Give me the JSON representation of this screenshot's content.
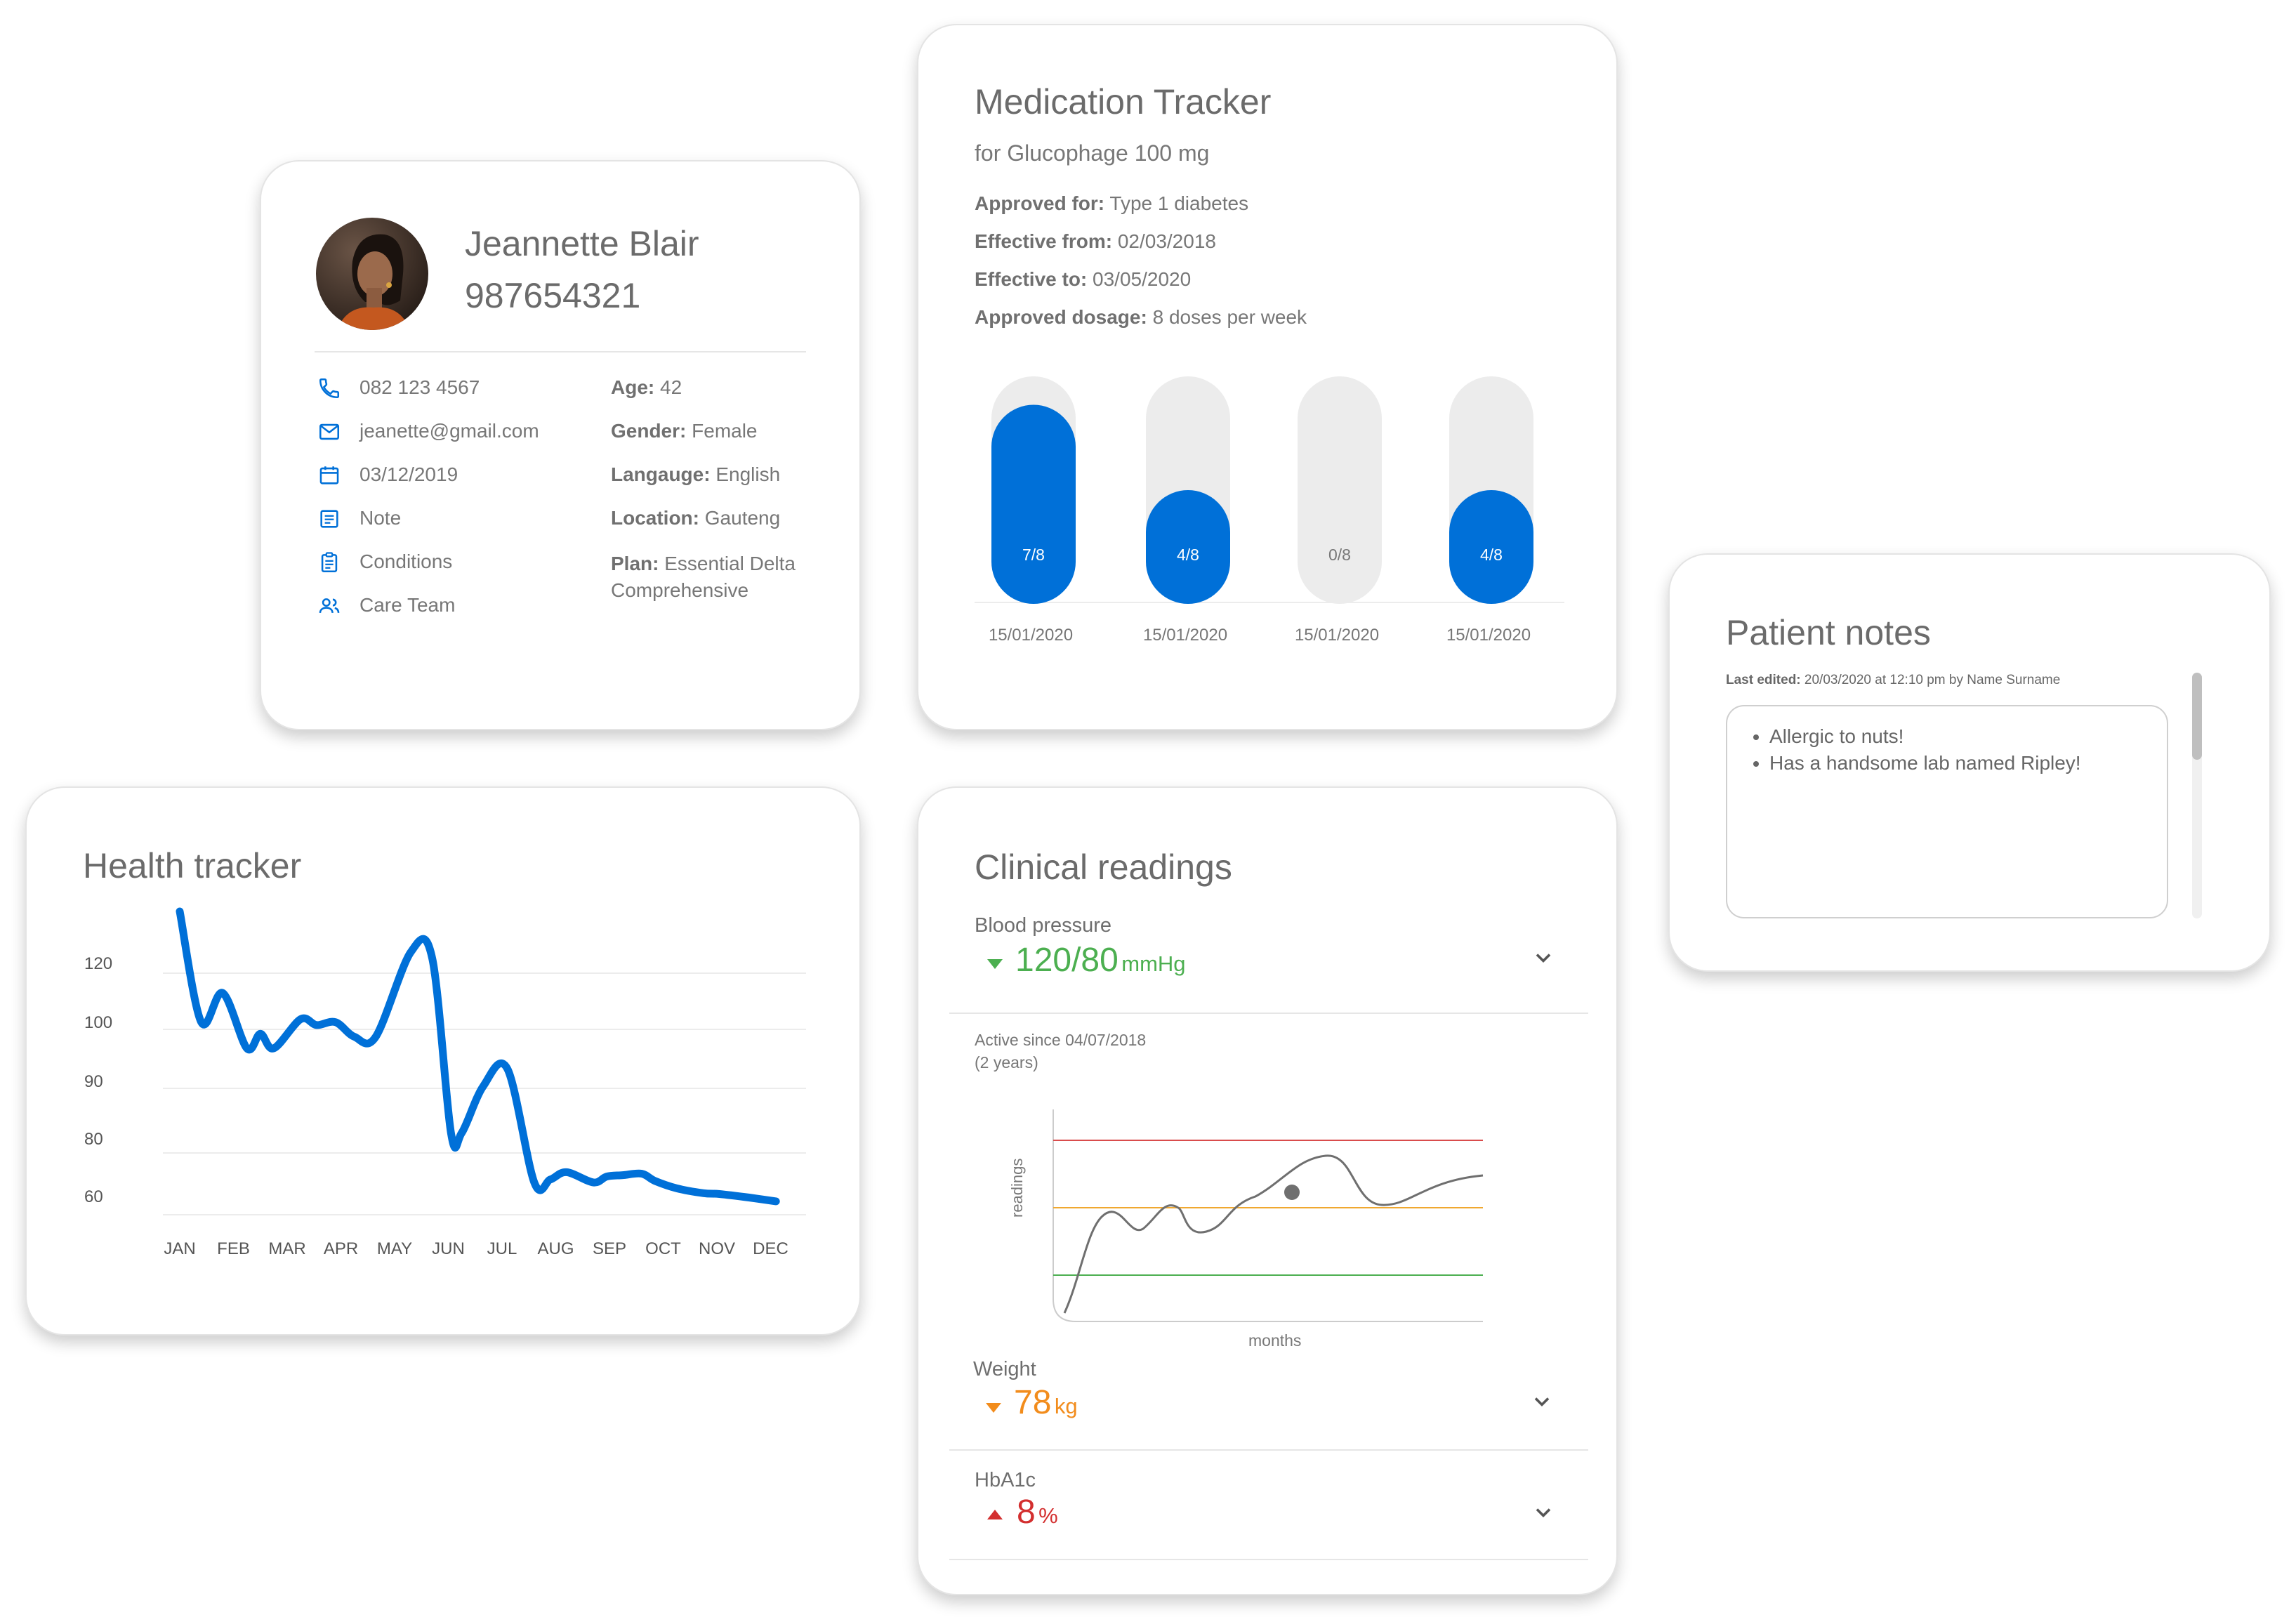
{
  "colors": {
    "accent": "#0070d8",
    "track": "#ececec",
    "green": "#4caf50",
    "orange": "#f28c1c",
    "red": "#d32f2f"
  },
  "patient": {
    "name": "Jeannette Blair",
    "id": "987654321",
    "contact": [
      {
        "icon": "phone-icon",
        "text": "082 123 4567"
      },
      {
        "icon": "mail-icon",
        "text": "jeanette@gmail.com"
      },
      {
        "icon": "calendar-icon",
        "text": "03/12/2019"
      },
      {
        "icon": "note-icon",
        "text": "Note"
      },
      {
        "icon": "clipboard-icon",
        "text": "Conditions"
      },
      {
        "icon": "people-icon",
        "text": "Care Team"
      }
    ],
    "details": [
      {
        "label": "Age:",
        "value": "42"
      },
      {
        "label": "Gender:",
        "value": "Female"
      },
      {
        "label": "Langauge:",
        "value": "English"
      },
      {
        "label": "Location:",
        "value": "Gauteng"
      },
      {
        "label": "Plan:",
        "value": "Essential Delta Comprehensive"
      }
    ]
  },
  "medication": {
    "title": "Medication Tracker",
    "subtitle": "for Glucophage 100 mg",
    "info": [
      {
        "label": "Approved for:",
        "value": "Type 1 diabetes"
      },
      {
        "label": "Effective from:",
        "value": "02/03/2018"
      },
      {
        "label": "Effective to:",
        "value": "03/05/2020"
      },
      {
        "label": "Approved dosage:",
        "value": "8 doses per week"
      }
    ],
    "doses": [
      {
        "label": "7/8",
        "taken": 7,
        "total": 8,
        "date": "15/01/2020"
      },
      {
        "label": "4/8",
        "taken": 4,
        "total": 8,
        "date": "15/01/2020"
      },
      {
        "label": "0/8",
        "taken": 0,
        "total": 8,
        "date": "15/01/2020"
      },
      {
        "label": "4/8",
        "taken": 4,
        "total": 8,
        "date": "15/01/2020"
      }
    ]
  },
  "notes": {
    "title": "Patient notes",
    "last_edited_label": "Last edited:",
    "last_edited_value": "20/03/2020 at 12:10 pm by Name Surname",
    "items": [
      "Allergic to nuts!",
      "Has a handsome lab named Ripley!"
    ]
  },
  "health": {
    "title": "Health tracker"
  },
  "chart_data": {
    "type": "line",
    "title": "Health tracker",
    "categories": [
      "JAN",
      "FEB",
      "MAR",
      "APR",
      "MAY",
      "JUN",
      "JUL",
      "AUG",
      "SEP",
      "OCT",
      "NOV",
      "DEC"
    ],
    "y_ticks": [
      "120",
      "100",
      "90",
      "80",
      "60"
    ],
    "x": [
      0,
      0.4,
      0.8,
      1.25,
      1.5,
      1.75,
      2.25,
      2.55,
      2.9,
      3.25,
      3.65,
      4.3,
      4.7,
      5.05,
      5.25,
      5.65,
      6.1,
      6.6,
      6.9,
      7.2,
      7.7,
      7.95,
      8.25,
      8.6,
      8.85,
      9.25,
      9.75,
      10.05,
      10.6,
      11.1
    ],
    "y": [
      120,
      101,
      106,
      96.5,
      99,
      96.5,
      101.5,
      100.5,
      101,
      98.5,
      98.5,
      113,
      112,
      84,
      84,
      90,
      93,
      67,
      68,
      70.5,
      67,
      69,
      69.5,
      70,
      67.5,
      65,
      63.3,
      63,
      61.8,
      60.5
    ],
    "ylim": [
      50,
      120
    ],
    "grid": true,
    "color": "#0070d8"
  },
  "clinical": {
    "title": "Clinical readings",
    "bp": {
      "name": "Blood pressure",
      "value": "120/80",
      "unit": "mmHg",
      "trend": "down"
    },
    "active_since": "Active since 04/07/2018",
    "duration": "(2 years)",
    "mini_chart": {
      "ylabel": "readings",
      "xlabel": "months"
    },
    "weight": {
      "name": "Weight",
      "value": "78",
      "unit": "kg",
      "trend": "down"
    },
    "hba1c": {
      "name": "HbA1c",
      "value": "8",
      "unit": "%",
      "trend": "up"
    }
  }
}
